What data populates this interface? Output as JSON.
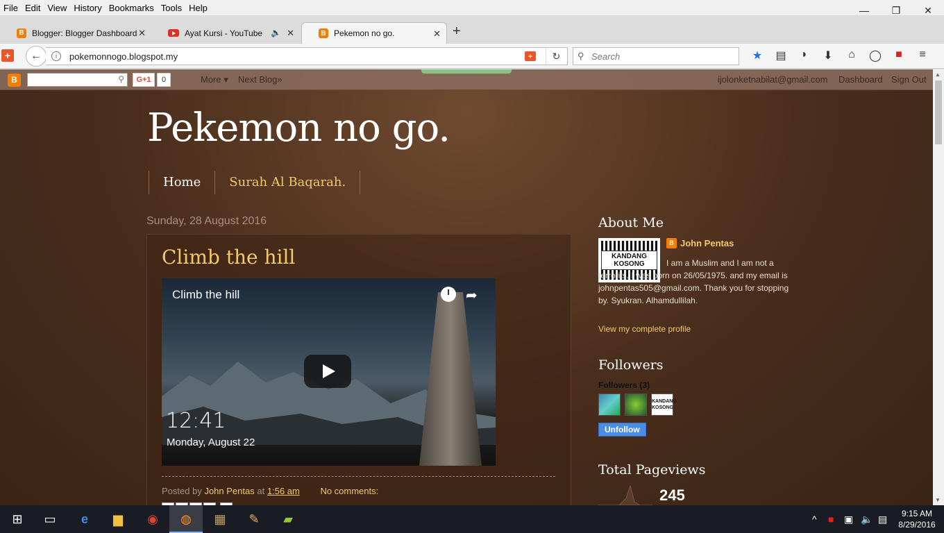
{
  "menu": [
    "File",
    "Edit",
    "View",
    "History",
    "Bookmarks",
    "Tools",
    "Help"
  ],
  "window_controls": {
    "minimize": "—",
    "maximize": "❐",
    "close": "✕"
  },
  "tabs": [
    {
      "title": "Blogger: Blogger Dashboard",
      "icon": "blogger-icon"
    },
    {
      "title": "Ayat Kursi - YouTube",
      "icon": "youtube-icon"
    },
    {
      "title": "Pekemon no go.",
      "icon": "blogger-icon"
    }
  ],
  "tab_close": "✕",
  "new_tab": "+",
  "address": {
    "url": "pokemonnogo.blogspot.my"
  },
  "search": {
    "placeholder": "Search"
  },
  "blogger_nav": {
    "gplus": "G+1",
    "gcount": "0",
    "more": "More ▾",
    "next_blog": "Next Blog»",
    "email": "ijolonketnabilat@gmail.com",
    "dashboard": "Dashboard",
    "sign_out": "Sign Out"
  },
  "blog": {
    "title": "Pekemon no go.",
    "tabs": [
      "Home",
      "Surah Al Baqarah."
    ]
  },
  "post": {
    "date": "Sunday, 28 August 2016",
    "title": "Climb the hill",
    "video": {
      "title": "Climb the hill",
      "time": "12:41",
      "date": "Monday, August 22"
    },
    "footer": {
      "posted_by": "Posted by",
      "author": "John Pentas",
      "at": "at",
      "time": "1:56 am",
      "comments": "No comments:"
    }
  },
  "sidebar": {
    "about_heading": "About Me",
    "profile_sign": "KANDANG KOSONG",
    "profile_name": "John Pentas",
    "profile_text": "I am a Muslim and I am not a terrorits. I was born on 26/05/1975. and my email is johnpentas505@gmail.com. Thank you for stopping by. Syukran. Alhamdullilah.",
    "profile_link": "View my complete profile",
    "followers_heading": "Followers",
    "followers_count": "Followers (3)",
    "follower_thumb3": "KANDANG KOSONG",
    "unfollow": "Unfollow",
    "pageviews_heading": "Total Pageviews",
    "pageviews": "245"
  },
  "taskbar": {
    "time": "9:15 AM",
    "date": "8/29/2016"
  }
}
